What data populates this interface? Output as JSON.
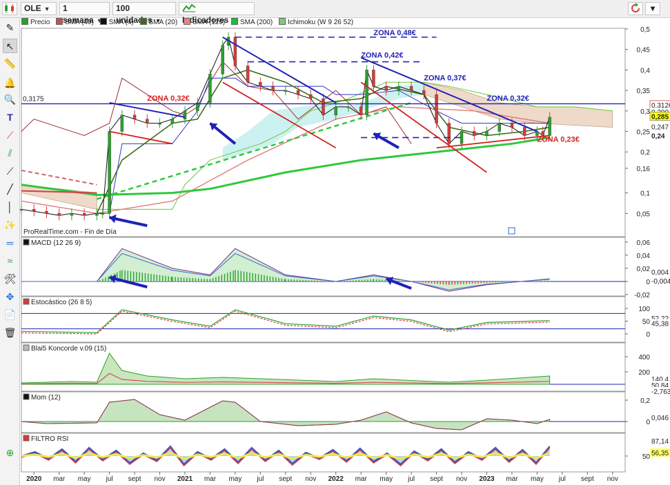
{
  "toolbar": {
    "ticker": "OLE",
    "period": "1 semana",
    "units": "100 unidades",
    "indicators_label": "Indicadores"
  },
  "legend": [
    {
      "label": "Precio",
      "color": "#2aa02a"
    },
    {
      "label": "SMA (40)",
      "color": "#c85050"
    },
    {
      "label": "SMA (4)",
      "color": "#111111"
    },
    {
      "label": "SMA (20)",
      "color": "#3d6e1a"
    },
    {
      "label": "SMA (120)",
      "color": "#f08080"
    },
    {
      "label": "SMA (200)",
      "color": "#22bb33"
    },
    {
      "label": "Ichimoku (W 9 26 52)",
      "color": "#7ec87e"
    }
  ],
  "branding": "ProRealTime.com - Fin de Día",
  "colors": {
    "up": "#2ca02c",
    "down": "#d43c3c",
    "trend_blue": "#1f22b5",
    "trend_red": "#d42020",
    "sma200": "#2ec83c",
    "sma40": "#9c2d2d",
    "sma20": "#3d6e1a",
    "sma4": "#111111",
    "sma120": "#e07b7b",
    "cloud_bull": "#c6f0f0",
    "cloud_bear": "#efd9c8",
    "kijun": "#3333cc",
    "tenkan": "#cc3333"
  },
  "chart_data": [
    {
      "name": "price",
      "type": "candlestick",
      "y_ticks": [
        "0,5",
        "0,45",
        "0,4",
        "0,35",
        "0,3",
        "0,25",
        "0,2",
        "0,16",
        "0,1",
        "0,05"
      ],
      "y_range": [
        0.0,
        0.5
      ],
      "x_tick_labels": [
        "2020",
        "mar",
        "may",
        "jul",
        "sept",
        "nov",
        "2021",
        "mar",
        "may",
        "jul",
        "sept",
        "nov",
        "2022",
        "mar",
        "may",
        "jul",
        "sept",
        "nov",
        "2023",
        "mar",
        "may",
        "jul",
        "sept",
        "nov"
      ],
      "x_bold": [
        "2020",
        "2021",
        "2022",
        "2023"
      ],
      "x_range": [
        "2019-12",
        "2023-12"
      ],
      "horizontal_line": {
        "value": 0.3175,
        "label": "0,3175"
      },
      "last_price_labels": [
        {
          "text": "0,3126",
          "value": 0.315,
          "bg": "#ffffff",
          "fg": "#d04040",
          "border": "#d04040"
        },
        {
          "text": "0,290",
          "value": 0.298,
          "bg": "#ffffff",
          "fg": "#333333",
          "border": ""
        },
        {
          "text": "0,285",
          "value": 0.287,
          "bg": "#ffff00",
          "fg": "#000000",
          "border": "#888888"
        },
        {
          "text": "0,247",
          "value": 0.262,
          "bg": "#ffffff",
          "fg": "#c04040",
          "border": ""
        },
        {
          "text": "0,24",
          "value": 0.24,
          "bg": "#ffffff",
          "fg": "#1a9a1a",
          "border": ""
        }
      ],
      "annotations": [
        {
          "text": "ZONA 0,48€",
          "date": "2022-04",
          "value": 0.485,
          "color": "#1f22b5"
        },
        {
          "text": "ZONA 0,42€",
          "date": "2022-03",
          "value": 0.43,
          "color": "#1f22b5"
        },
        {
          "text": "ZONA 0,37€",
          "date": "2022-08",
          "value": 0.375,
          "color": "#1f22b5"
        },
        {
          "text": "ZONA 0,32€",
          "date": "2023-01",
          "value": 0.325,
          "color": "#1f22b5"
        },
        {
          "text": "ZONA 0,32€",
          "date": "2020-10",
          "value": 0.325,
          "color": "#d42020"
        },
        {
          "text": "ZONA 0,23€",
          "date": "2023-05",
          "value": 0.225,
          "color": "#d42020"
        }
      ],
      "series": [
        {
          "name": "Precio",
          "date": [
            "2019-12",
            "2020-01",
            "2020-02",
            "2020-03",
            "2020-04",
            "2020-05",
            "2020-06",
            "2020-06-15",
            "2020-07",
            "2020-08",
            "2020-09",
            "2020-10",
            "2020-11",
            "2020-12",
            "2021-01",
            "2021-02",
            "2021-03",
            "2021-04",
            "2021-04-15",
            "2021-05",
            "2021-06",
            "2021-07",
            "2021-08",
            "2021-09",
            "2021-10",
            "2021-11",
            "2021-12",
            "2022-01",
            "2022-02",
            "2022-03",
            "2022-03-15",
            "2022-04",
            "2022-05",
            "2022-06",
            "2022-07",
            "2022-08",
            "2022-09",
            "2022-10",
            "2022-11",
            "2022-12",
            "2023-01",
            "2023-02",
            "2023-03",
            "2023-04",
            "2023-05",
            "2023-05-15",
            "2023-06"
          ],
          "close": [
            0.06,
            0.055,
            0.05,
            0.045,
            0.05,
            0.045,
            0.05,
            0.05,
            0.25,
            0.29,
            0.28,
            0.27,
            0.27,
            0.28,
            0.3,
            0.32,
            0.39,
            0.46,
            0.48,
            0.41,
            0.37,
            0.36,
            0.35,
            0.35,
            0.34,
            0.33,
            0.29,
            0.31,
            0.31,
            0.29,
            0.4,
            0.36,
            0.35,
            0.36,
            0.35,
            0.34,
            0.27,
            0.22,
            0.25,
            0.24,
            0.25,
            0.27,
            0.26,
            0.24,
            0.25,
            0.24,
            0.285
          ]
        },
        {
          "name": "SMA (200)",
          "date": [
            "2019-12",
            "2020-06",
            "2020-12",
            "2021-03",
            "2021-09",
            "2022-03",
            "2022-09",
            "2023-03",
            "2023-06"
          ],
          "value": [
            0.12,
            0.095,
            0.1,
            0.11,
            0.15,
            0.18,
            0.2,
            0.22,
            0.235
          ]
        },
        {
          "name": "SMA (120)",
          "date": [
            "2019-12",
            "2020-06",
            "2020-12",
            "2021-06",
            "2022-01",
            "2022-06",
            "2022-12",
            "2023-06"
          ],
          "value": [
            0.08,
            0.05,
            0.08,
            0.18,
            0.28,
            0.31,
            0.3,
            0.27
          ]
        }
      ]
    },
    {
      "name": "macd",
      "type": "line",
      "title": "MACD (12 26 9)",
      "y_ticks": [
        "0,06",
        "0,04",
        "0,02",
        "0",
        "-0,02"
      ],
      "value_labels": [
        {
          "text": "0,004",
          "bg": "#ffffff",
          "fg": "#1a9a1a"
        },
        {
          "text": "-0,004",
          "bg": "#ffffff",
          "fg": "#d04040"
        }
      ],
      "series": [
        {
          "name": "MACD",
          "date": [
            "2019-12",
            "2020-06",
            "2020-08",
            "2020-12",
            "2021-03",
            "2021-05",
            "2021-09",
            "2022-01",
            "2022-04",
            "2022-07",
            "2022-10",
            "2023-01",
            "2023-06"
          ],
          "value": [
            0.0,
            0.0,
            0.05,
            0.02,
            0.01,
            0.05,
            0.01,
            0.0,
            0.01,
            0.0,
            -0.015,
            -0.005,
            0.004
          ]
        }
      ]
    },
    {
      "name": "stochastic",
      "type": "line",
      "title": "Estocástico (26 8 5)",
      "y_ticks": [
        "100",
        "50",
        "0"
      ],
      "value_labels": [
        {
          "text": "52,22",
          "bg": "#ffffff",
          "fg": "#1a9a1a"
        },
        {
          "text": "45,38",
          "bg": "#ffffff",
          "fg": "#d04040"
        }
      ],
      "series": [
        {
          "name": "%K",
          "date": [
            "2019-12",
            "2020-06",
            "2020-08",
            "2020-12",
            "2021-03",
            "2021-05",
            "2021-09",
            "2022-01",
            "2022-04",
            "2022-07",
            "2022-10",
            "2023-01",
            "2023-06"
          ],
          "value": [
            10,
            5,
            95,
            55,
            30,
            95,
            40,
            30,
            70,
            55,
            15,
            45,
            52
          ]
        }
      ]
    },
    {
      "name": "koncorde",
      "type": "area",
      "title": "Blai5 Koncorde v.09 (15)",
      "y_ticks": [
        "400",
        "200"
      ],
      "value_labels": [
        {
          "text": "140,4",
          "bg": "#ffffff",
          "fg": "#1a9a1a"
        },
        {
          "text": "50,84",
          "bg": "#ffffff",
          "fg": "#d04040"
        },
        {
          "text": "-2,763",
          "bg": "#ffffff",
          "fg": "#3366cc"
        }
      ]
    },
    {
      "name": "momentum",
      "type": "area",
      "title": "Mom (12)",
      "y_ticks": [
        "0,2",
        "0"
      ],
      "value_labels": [
        {
          "text": "0,046",
          "bg": "#ffffff",
          "fg": "#222222"
        }
      ]
    },
    {
      "name": "filtro_rsi",
      "type": "line",
      "title": "FILTRO RSI",
      "y_ticks": [
        "50"
      ],
      "value_labels": [
        {
          "text": "87,14",
          "bg": "#ffffff",
          "fg": "#3355cc"
        },
        {
          "text": "56,35",
          "bg": "#ffff66",
          "fg": "#222222"
        }
      ]
    }
  ]
}
